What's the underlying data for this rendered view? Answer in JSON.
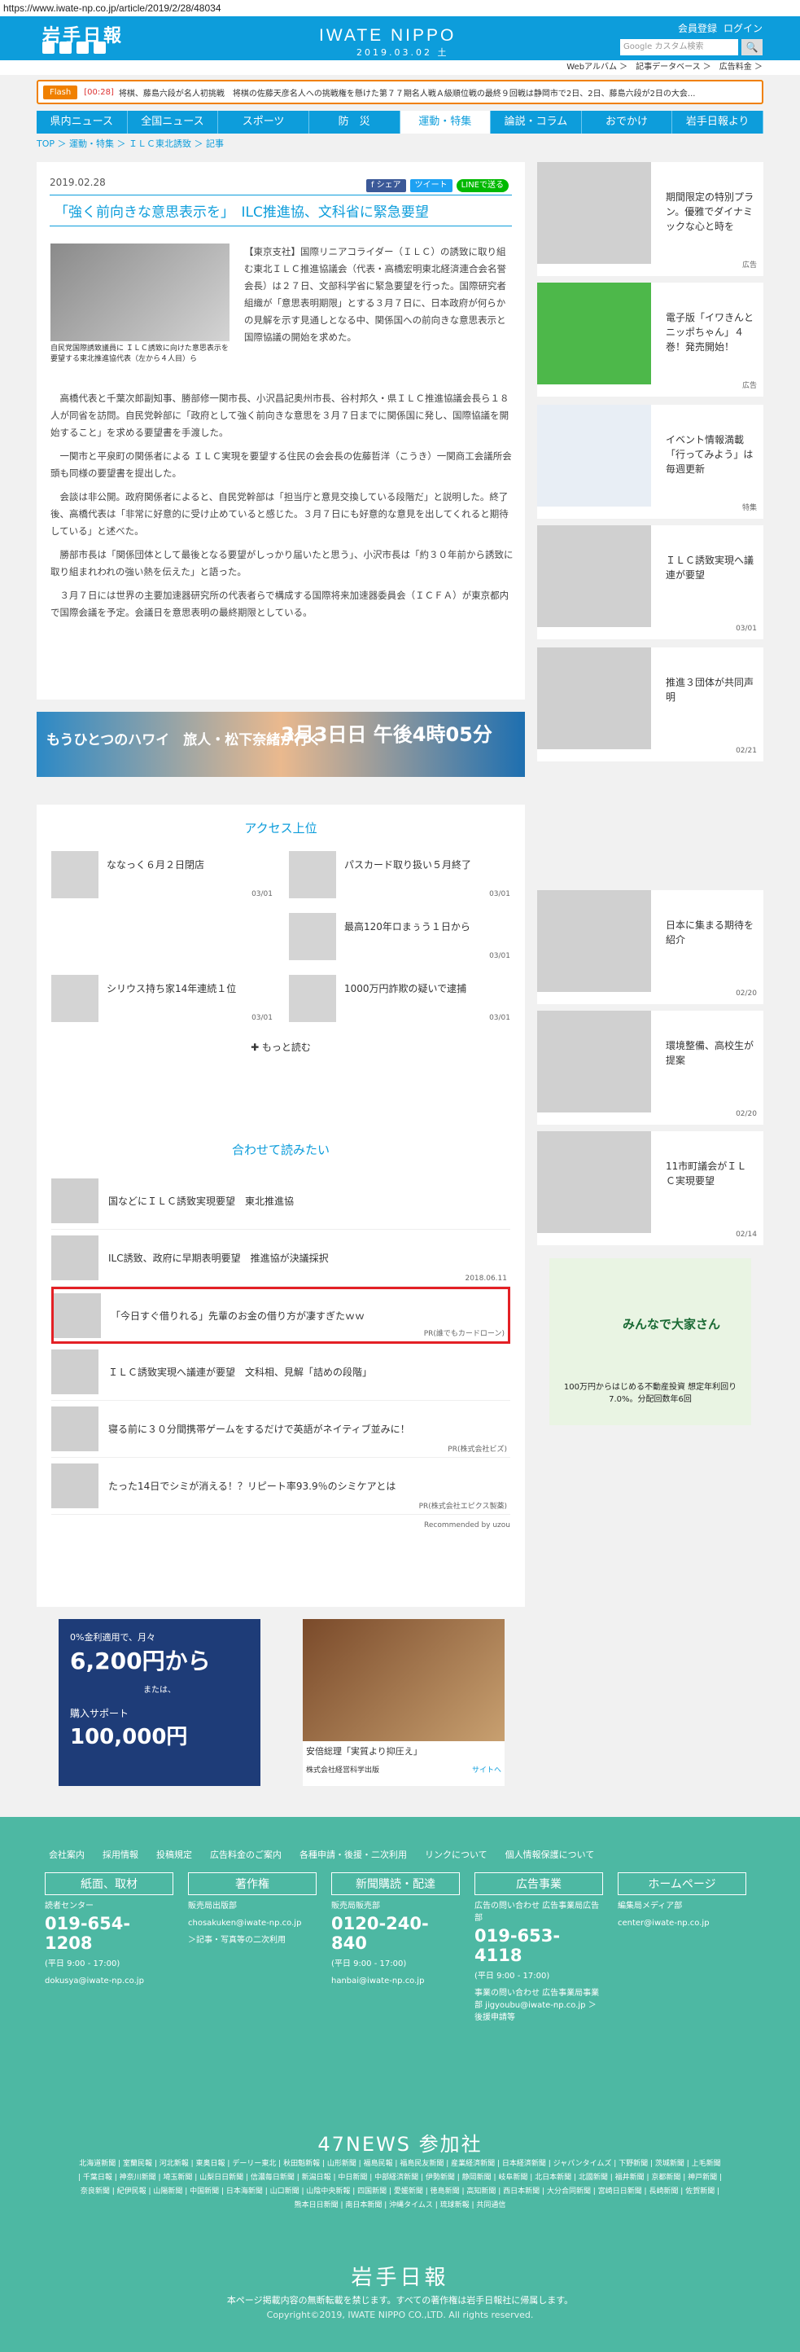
{
  "url": "https://www.iwate-np.co.jp/article/2019/2/28/48034",
  "header": {
    "logo": "岩手日報",
    "brand": "IWATE NIPPO",
    "date": "2019.03.02 土",
    "links": [
      "会員登録",
      "ログイン"
    ],
    "search_placeholder": "Google カスタム検索",
    "search_btn": "🔍"
  },
  "subbar": "Webアルバム ＞　記事データベース ＞　広告料金 ＞",
  "flash": {
    "tag": "Flash",
    "time": "[00:28]",
    "text": "将棋、藤島六段が名人初挑戦　将棋の佐藤天彦名人への挑戦権を懸けた第７７期名人戦Ａ級順位戦の最終９回戦は静岡市で2日、2日、藤島六段が2日の大会..."
  },
  "nav": [
    "県内ニュース",
    "全国ニュース",
    "スポーツ",
    "防　災",
    "運動・特集",
    "論説・コラム",
    "おでかけ",
    "岩手日報より"
  ],
  "breadcrumb": "TOP ＞ 運動・特集 ＞ ＩＬＣ東北誘致 ＞ 記事",
  "article": {
    "date": "2019.02.28",
    "share": [
      "f シェア",
      "ツイート",
      "LINEで送る"
    ],
    "title": "「強く前向きな意思表示を」　ILC推進協、文科省に緊急要望",
    "caption": "自民党国際誘致議員に ＩＬＣ誘致に向けた意思表示を要望する東北推進協代表（左から４人目）ら",
    "lead": "【東京支社】国際リニアコライダー（ＩＬＣ）の誘致に取り組む東北ＩＬＣ推進協議会（代表・高橋宏明東北経済連合会名誉会長）は２７日、文部科学省に緊急要望を行った。国際研究者組織が「意思表明期限」とする３月７日に、日本政府が何らかの見解を示す見通しとなる中、関係国への前向きな意思表示と国際協議の開始を求めた。",
    "paragraphs": [
      "高橋代表と千葉次郎副知事、勝部修一関市長、小沢昌記奥州市長、谷村邦久・県ＩＬＣ推進協議会長ら１８人が同省を訪問。自民党幹部に「政府として強く前向きな意思を３月７日までに関係国に発し、国際協議を開始すること」を求める要望書を手渡した。",
      "一関市と平泉町の関係者による ＩＬＣ実現を要望する住民の会会長の佐藤哲洋（こうき）一関商工会議所会頭も同様の要望書を提出した。",
      "会談は非公開。政府関係者によると、自民党幹部は「担当庁と意見交換している段階だ」と説明した。終了後、高橋代表は「非常に好意的に受け止めていると感じた。３月７日にも好意的な意見を出してくれると期待している」と述べた。",
      "勝部市長は「関係団体として最後となる要望がしっかり届いたと思う」、小沢市長は「約３０年前から誘致に取り組まれわれの強い熱を伝えた」と語った。",
      "３月７日には世界の主要加速器研究所の代表者らで構成する国際将来加速器委員会（ＩＣＦＡ）が東京都内で国際会議を予定。会議日を意思表明の最終期限としている。"
    ]
  },
  "ad_banner": {
    "left": "もうひとつのハワイ　旅人・松下奈緒が行く",
    "right": "3月3日日 午後4時05分"
  },
  "ranking": {
    "title": "アクセス上位",
    "items": [
      {
        "text": "ななっく６月２日閉店",
        "date": "03/01"
      },
      {
        "text": "パスカード取り扱い５月終了",
        "date": "03/01"
      },
      {
        "text": "",
        "date": ""
      },
      {
        "text": "最高120年ロまぅう１日から",
        "date": "03/01"
      },
      {
        "text": "シリウス持ち家14年連続１位",
        "date": "03/01"
      },
      {
        "text": "1000万円詐欺の疑いで逮捕",
        "date": "03/01"
      }
    ],
    "more": "✚ もっと読む"
  },
  "related": {
    "title": "合わせて読みたい",
    "items": [
      {
        "text": "国などにＩＬＣ誘致実現要望　東北推進協",
        "src": ""
      },
      {
        "text": "ILC誘致、政府に早期表明要望　推進協が決議採択",
        "src": "2018.06.11"
      },
      {
        "text": "「今日すぐ借りれる」先輩のお金の借り方が凄すぎたｗｗ",
        "src": "PR(誰でもカードローン)"
      },
      {
        "text": "ＩＬＣ誘致実現へ議連が要望　文科相、見解「詰めの段階」",
        "src": ""
      },
      {
        "text": "寝る前に３０分間携帯ゲームをするだけで英語がネイティブ並みに！",
        "src": "PR(株式会社ビズ)"
      },
      {
        "text": "たった14日でシミが消える！？リピート率93.9％のシミケアとは",
        "src": "PR(株式会社エピクス製薬)"
      }
    ],
    "credit": "Recommended by uzou"
  },
  "ad2": {
    "l1": "0%金利適用で、月々",
    "l2": "6,200円から",
    "l3": "または、",
    "l4": "購入サポート",
    "l5": "100,000円"
  },
  "ad3": {
    "caption": "安倍総理「実質より抑圧え」",
    "src": "株式会社経営科学出版",
    "link": "サイトへ"
  },
  "side": [
    {
      "text": "期間限定の特別プラン。優雅でダイナミックな心と時を",
      "tag": "広告"
    },
    {
      "text": "電子版「イワきんとニッポちゃん」４巻！発売開始！",
      "tag": "広告"
    },
    {
      "text": "イベント情報満載「行ってみよう」は毎週更新",
      "tag": "特集"
    },
    {
      "text": "ＩＬＣ誘致実現へ議連が要望",
      "tag": "03/01"
    },
    {
      "text": "推進３団体が共同声明",
      "tag": "02/21"
    },
    {
      "text": "日本に集まる期待を紹介",
      "tag": "02/20"
    },
    {
      "text": "環境整備、高校生が提案",
      "tag": "02/20"
    },
    {
      "text": "11市町議会がＩＬＣ実現要望",
      "tag": "02/14"
    }
  ],
  "side_ad": {
    "title": "みんなで大家さん",
    "note": "100万円からはじめる不動産投資 想定年利回り7.0%。分配回数年6回"
  },
  "footer": {
    "links": [
      "会社案内",
      "採用情報",
      "投稿規定",
      "広告料金のご案内",
      "各種申請・後援・二次利用",
      "リンクについて",
      "個人情報保護について"
    ],
    "cols": [
      {
        "h": "紙面、取材",
        "l1": "読者センター",
        "ph": "019-654-1208",
        "l2": "(平日 9:00 - 17:00)",
        "l3": "dokusya@iwate-np.co.jp"
      },
      {
        "h": "著作権",
        "l1": "販売局出版部",
        "ph": "",
        "l2": "chosakuken@iwate-np.co.jp",
        "l3": "＞記事・写真等の二次利用"
      },
      {
        "h": "新聞購読・配達",
        "l1": "販売局販売部",
        "ph": "0120-240-840",
        "l2": "(平日 9:00 - 17:00)",
        "l3": "hanbai@iwate-np.co.jp"
      },
      {
        "h": "広告事業",
        "l1": "広告の問い合わせ 広告事業局広告部",
        "ph": "019-653-4118",
        "l2": "(平日 9:00 - 17:00)",
        "l3": "事業の問い合わせ 広告事業局事業部 jigyoubu@iwate-np.co.jp ＞後援申請等"
      },
      {
        "h": "ホームページ",
        "l1": "編集局メディア部",
        "ph": "",
        "l2": "center@iwate-np.co.jp",
        "l3": ""
      }
    ],
    "n47": "47NEWS 参加社",
    "papers": "北海道新聞 | 室蘭民報 | 河北新報 | 東奥日報 | デーリー東北 | 秋田魁新報 | 山形新聞 | 福島民報 | 福島民友新聞 | 産業経済新聞 | 日本経済新聞 | ジャパンタイムズ | 下野新聞 | 茨城新聞 | 上毛新聞 | 千葉日報 | 神奈川新聞 | 埼玉新聞 | 山梨日日新聞 | 信濃毎日新聞 | 新潟日報 | 中日新聞 | 中部経済新聞 | 伊勢新聞 | 静岡新聞 | 岐阜新聞 | 北日本新聞 | 北國新聞 | 福井新聞 | 京都新聞 | 神戸新聞 | 奈良新聞 | 紀伊民報 | 山陽新聞 | 中国新聞 | 日本海新聞 | 山口新聞 | 山陰中央新報 | 四国新聞 | 愛媛新聞 | 徳島新聞 | 高知新聞 | 西日本新聞 | 大分合同新聞 | 宮崎日日新聞 | 長崎新聞 | 佐賀新聞 | 熊本日日新聞 | 南日本新聞 | 沖縄タイムス | 琉球新報 | 共同通信",
    "logo": "岩手日報",
    "note": "本ページ掲載内容の無断転載を禁じます。すべての著作権は岩手日報社に帰属します。",
    "copy": "Copyright©2019, IWATE NIPPO CO.,LTD. All rights reserved."
  }
}
